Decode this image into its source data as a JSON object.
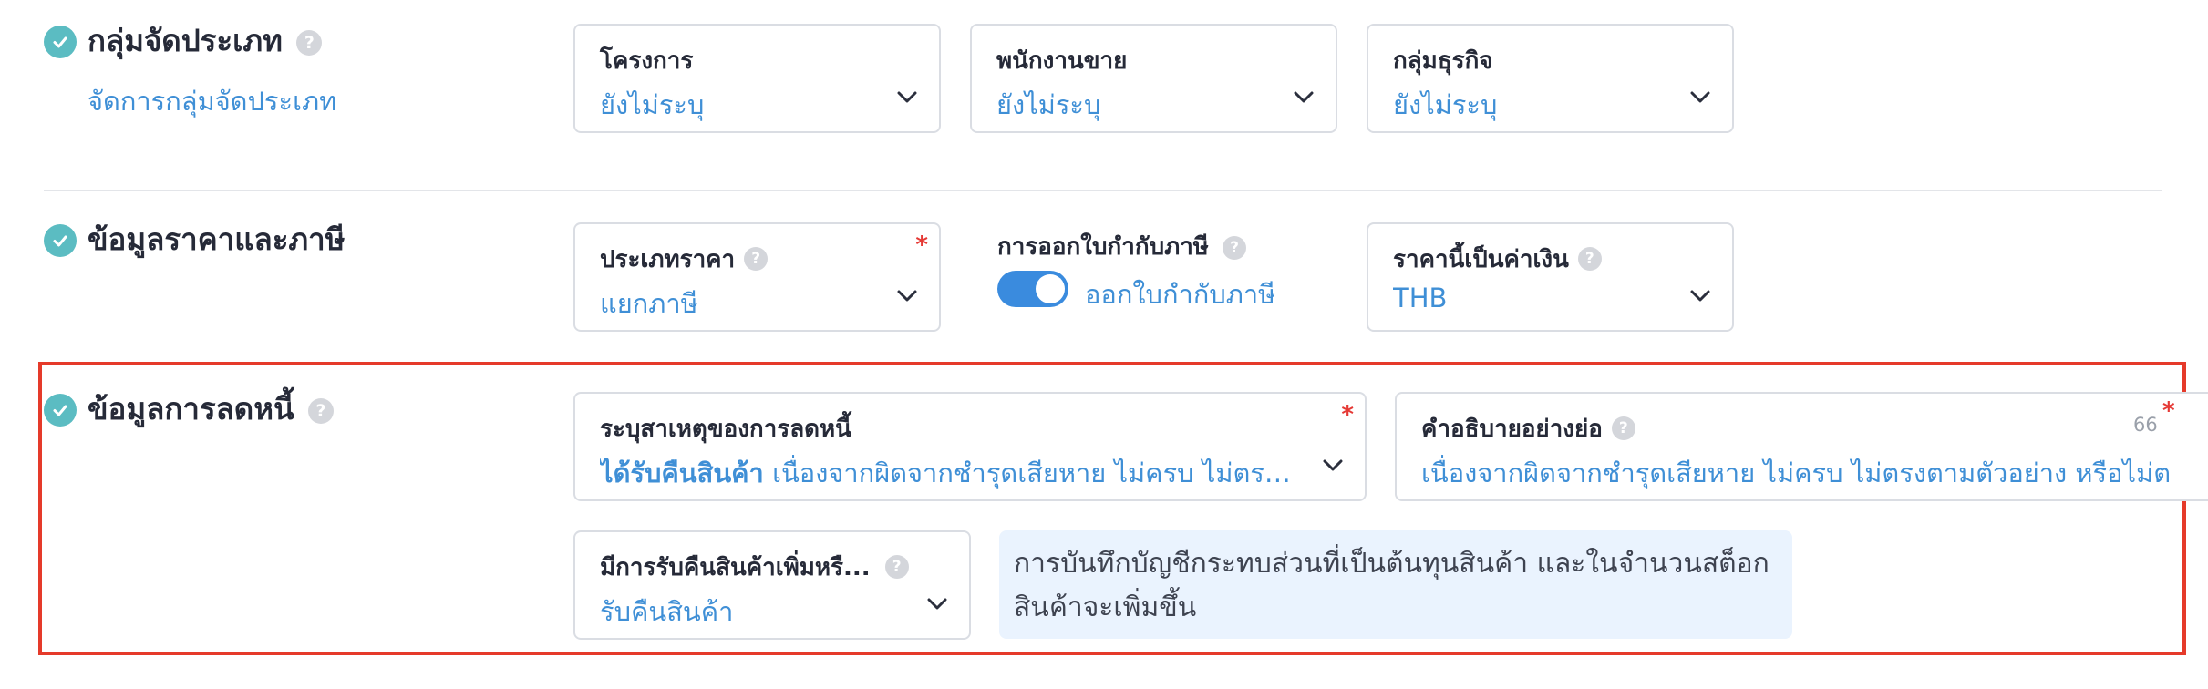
{
  "sections": {
    "category": {
      "title": "กลุ่มจัดประเภท",
      "link": "จัดการกลุ่มจัดประเภท",
      "fields": [
        {
          "label": "โครงการ",
          "value": "ยังไม่ระบุ"
        },
        {
          "label": "พนักงานขาย",
          "value": "ยังไม่ระบุ"
        },
        {
          "label": "กลุ่มธุรกิจ",
          "value": "ยังไม่ระบุ"
        }
      ]
    },
    "price_tax": {
      "title": "ข้อมูลราคาและภาษี",
      "price_type": {
        "label": "ประเภทราคา",
        "value": "แยกภาษี",
        "required": "*"
      },
      "tax_invoice": {
        "label": "การออกใบกำกับภาษี",
        "toggle_label": "ออกใบกำกับภาษี",
        "enabled": true
      },
      "currency": {
        "label": "ราคานี้เป็นค่าเงิน",
        "value": "THB"
      }
    },
    "debt_reduction": {
      "title": "ข้อมูลการลดหนี้",
      "reason": {
        "label": "ระบุสาเหตุของการลดหนี้",
        "value_bold": "ได้รับคืนสินค้า",
        "value_rest": "เนื่องจากผิดจากชำรุดเสียหาย ไม่ครบ ไม่ตรง...",
        "required": "*"
      },
      "description": {
        "label": "คำอธิบายอย่างย่อ",
        "counter": "66",
        "value": "เนื่องจากผิดจากชำรุดเสียหาย ไม่ครบ ไม่ตรงตามตัวอย่าง หรือไม่ต",
        "required": "*"
      },
      "return_goods": {
        "label": "มีการรับคืนสินค้าเพิ่มหรื...",
        "value": "รับคืนสินค้า"
      },
      "info_text": "การบันทึกบัญชีกระทบส่วนที่เป็นต้นทุนสินค้า และในจำนวนสต็อกสินค้าจะเพิ่มขึ้น"
    }
  },
  "help_glyph": "?",
  "colors": {
    "accent": "#3f8fd6",
    "check": "#5bbcc2",
    "highlight": "#e53a2a",
    "toggle": "#3a8bde",
    "info_bg": "#eaf3fe"
  },
  "icons": [
    "check-circle-icon",
    "help-icon",
    "chevron-down-icon"
  ]
}
